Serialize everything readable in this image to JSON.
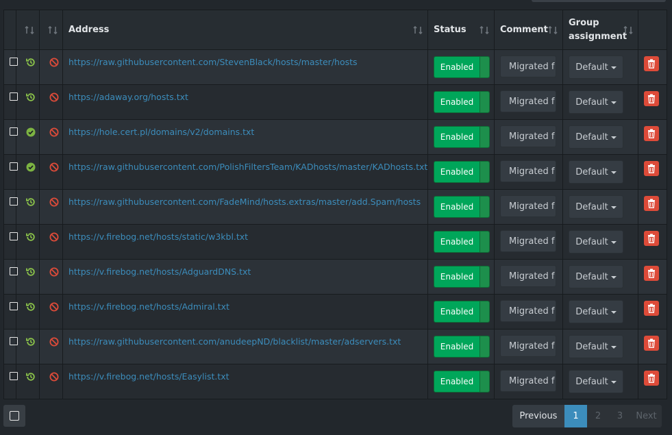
{
  "table": {
    "headers": {
      "address": "Address",
      "status": "Status",
      "comment": "Comment",
      "group_line1": "Group",
      "group_line2": "assignment"
    },
    "rows": [
      {
        "state": "history",
        "address": "https://raw.githubusercontent.com/StevenBlack/hosts/master/hosts",
        "status": "Enabled",
        "comment": "Migrated f",
        "group": "Default"
      },
      {
        "state": "history",
        "address": "https://adaway.org/hosts.txt",
        "status": "Enabled",
        "comment": "Migrated f",
        "group": "Default"
      },
      {
        "state": "check",
        "address": "https://hole.cert.pl/domains/v2/domains.txt",
        "status": "Enabled",
        "comment": "Migrated f",
        "group": "Default"
      },
      {
        "state": "check",
        "address": "https://raw.githubusercontent.com/PolishFiltersTeam/KADhosts/master/KADhosts.txt",
        "status": "Enabled",
        "comment": "Migrated f",
        "group": "Default"
      },
      {
        "state": "history",
        "address": "https://raw.githubusercontent.com/FadeMind/hosts.extras/master/add.Spam/hosts",
        "status": "Enabled",
        "comment": "Migrated f",
        "group": "Default"
      },
      {
        "state": "history",
        "address": "https://v.firebog.net/hosts/static/w3kbl.txt",
        "status": "Enabled",
        "comment": "Migrated f",
        "group": "Default"
      },
      {
        "state": "history",
        "address": "https://v.firebog.net/hosts/AdguardDNS.txt",
        "status": "Enabled",
        "comment": "Migrated f",
        "group": "Default"
      },
      {
        "state": "history",
        "address": "https://v.firebog.net/hosts/Admiral.txt",
        "status": "Enabled",
        "comment": "Migrated f",
        "group": "Default"
      },
      {
        "state": "history",
        "address": "https://raw.githubusercontent.com/anudeepND/blacklist/master/adservers.txt",
        "status": "Enabled",
        "comment": "Migrated f",
        "group": "Default"
      },
      {
        "state": "history",
        "address": "https://v.firebog.net/hosts/Easylist.txt",
        "status": "Enabled",
        "comment": "Migrated f",
        "group": "Default"
      }
    ]
  },
  "pagination": {
    "previous": "Previous",
    "pages": [
      "1",
      "2",
      "3"
    ],
    "current": "1",
    "next": "Next"
  },
  "colors": {
    "accent": "#3c8dbc",
    "enabled": "#00a65a",
    "delete": "#dd4b39",
    "history_icon": "#8bc34a",
    "check_icon": "#7cb342",
    "block_icon": "#dd4b39"
  }
}
